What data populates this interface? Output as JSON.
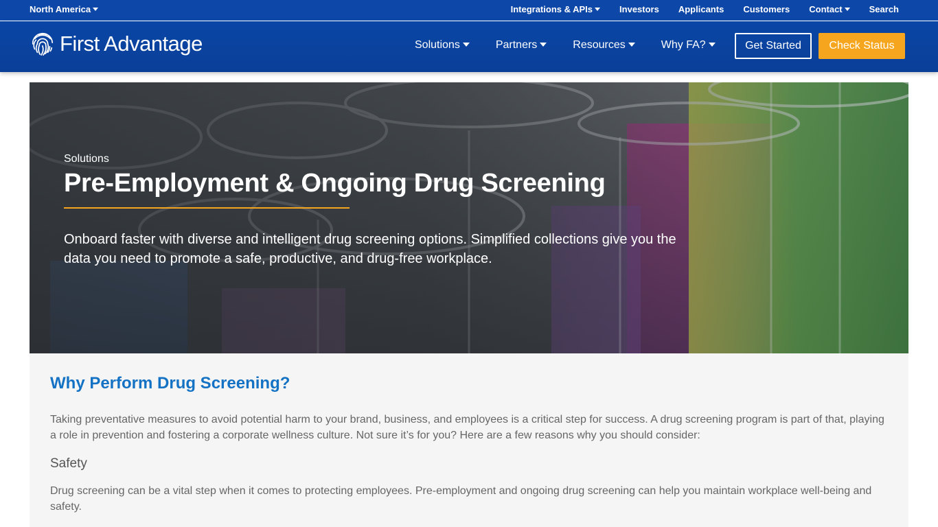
{
  "topbar": {
    "region": "North America",
    "links": [
      "Integrations & APIs",
      "Investors",
      "Applicants",
      "Customers",
      "Contact",
      "Search"
    ]
  },
  "header": {
    "brand": "First Advantage",
    "nav": [
      "Solutions",
      "Partners",
      "Resources",
      "Why FA?"
    ],
    "get_started": "Get Started",
    "check_status": "Check Status"
  },
  "hero": {
    "eyebrow": "Solutions",
    "title": "Pre-Employment & Ongoing Drug Screening",
    "lead": "Onboard faster with diverse and intelligent drug screening options. Simplified collections give you the data you need to promote a safe, productive, and drug-free workplace."
  },
  "content": {
    "heading": "Why Perform Drug Screening?",
    "intro": "Taking preventative measures to avoid potential harm to your brand, business, and employees is a critical step for success. A drug screening program is part of that, playing a role in prevention and fostering a corporate wellness culture. Not sure it’s for you? Here are a few reasons why you should consider:",
    "subheading": "Safety",
    "safety_text": "Drug screening can be a vital step when it comes to protecting employees. Pre-employment and ongoing drug screening can help you maintain workplace well-being and safety."
  },
  "colors": {
    "header_blue": "#0a46a6",
    "accent_orange": "#f6a61e",
    "heading_blue": "#1472c4"
  }
}
